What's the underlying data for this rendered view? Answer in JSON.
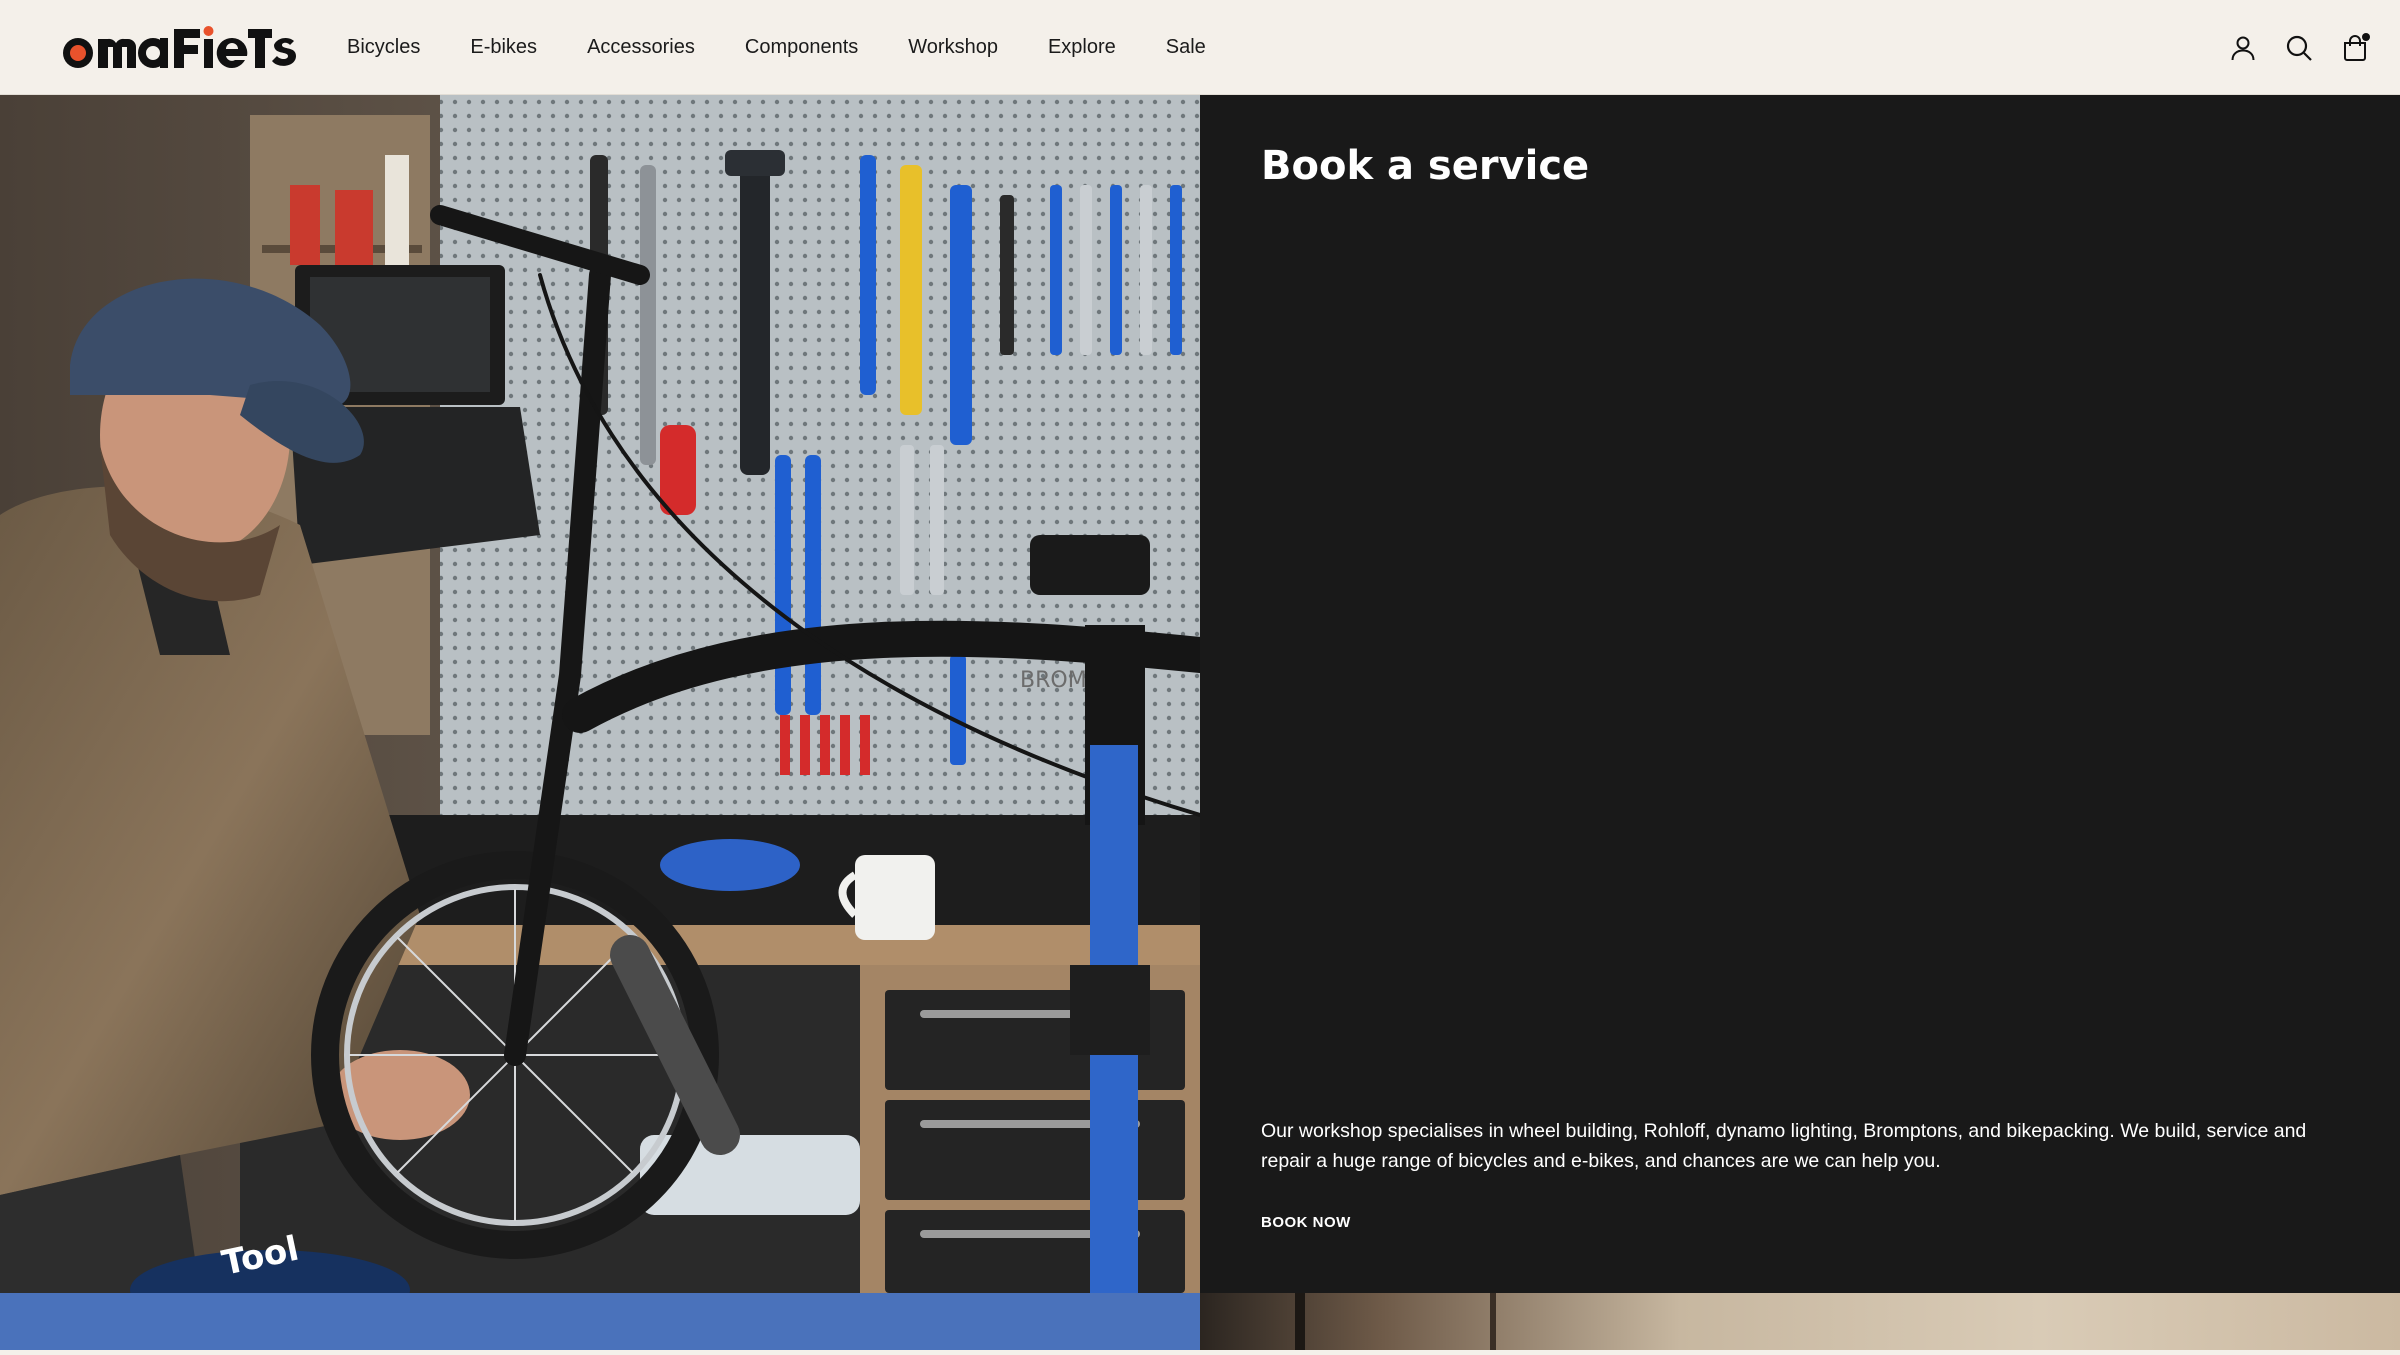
{
  "brand": {
    "logo_text": "omafiets"
  },
  "nav": {
    "items": [
      {
        "label": "Bicycles"
      },
      {
        "label": "E-bikes"
      },
      {
        "label": "Accessories"
      },
      {
        "label": "Components"
      },
      {
        "label": "Workshop"
      },
      {
        "label": "Explore"
      },
      {
        "label": "Sale"
      }
    ]
  },
  "header_icons": [
    "account-icon",
    "search-icon",
    "cart-icon"
  ],
  "hero": {
    "title": "Book a service",
    "description": "Our workshop specialises in wheel building, Rohloff, dynamo lighting, Bromptons, and bikepacking. We build, service and repair a huge range of bicycles and e-bikes, and chances are we can help you.",
    "cta_label": "BOOK NOW",
    "photo_signs": {
      "tin": "Tool",
      "brand_on_frame": "BROM"
    }
  },
  "colors": {
    "header_bg": "#f4f0ea",
    "panel_bg": "#191919",
    "accent_blue": "#4a72bb",
    "logo_orange": "#e9522c"
  }
}
